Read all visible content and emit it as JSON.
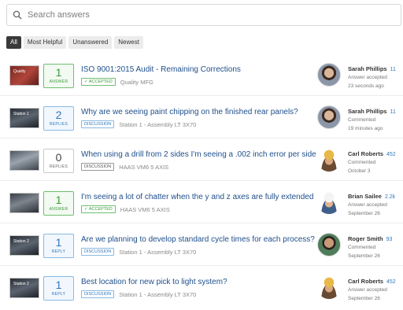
{
  "search": {
    "placeholder": "Search answers"
  },
  "filters": [
    "All",
    "Most Helpful",
    "Unanswered",
    "Newest"
  ],
  "rows": [
    {
      "thumb_label": "Quality",
      "count": "1",
      "count_label": "ANSWER",
      "count_style": "answered",
      "title": "ISO 9001:2015 Audit - Remaining Corrections",
      "tag": "✓ ACCEPTED",
      "tag_style": "accepted",
      "sub": "Quality MFG",
      "user": "Sarah Phillips",
      "rep": "11",
      "action": "Answer accepted",
      "when": "23 seconds ago"
    },
    {
      "thumb_label": "Station 1",
      "count": "2",
      "count_label": "REPLIES",
      "count_style": "replies",
      "title": "Why are we seeing paint chipping on the finished rear panels?",
      "tag": "DISCUSSION",
      "tag_style": "discussion",
      "sub": "Station 1 - Assembly LT 3X70",
      "user": "Sarah Phillips",
      "rep": "11",
      "action": "Commented",
      "when": "19 minutes ago"
    },
    {
      "thumb_label": "",
      "count": "0",
      "count_label": "REPLIES",
      "count_style": "plain",
      "title": "When using a drill from 2 sides I'm seeing a .002 inch error per side",
      "tag": "DISCUSSION",
      "tag_style": "plain",
      "sub": "HAAS VM6 5 AXIS",
      "user": "Carl Roberts",
      "rep": "452",
      "action": "Commented",
      "when": "October 3"
    },
    {
      "thumb_label": "",
      "count": "1",
      "count_label": "ANSWER",
      "count_style": "answered",
      "title": "I'm seeing a lot of chatter when the y and z axes are fully extended",
      "tag": "✓ ACCEPTED",
      "tag_style": "accepted",
      "sub": "HAAS VM6 5 AXIS",
      "user": "Brian Sailee",
      "rep": "2.2k",
      "action": "Answer accepted",
      "when": "September 26"
    },
    {
      "thumb_label": "Station 2",
      "count": "1",
      "count_label": "REPLY",
      "count_style": "replies",
      "title": "Are we planning to develop standard cycle times for each process?",
      "tag": "DISCUSSION",
      "tag_style": "discussion",
      "sub": "Station 1 - Assembly LT 3X70",
      "user": "Roger Smith",
      "rep": "93",
      "action": "Commented",
      "when": "September 26"
    },
    {
      "thumb_label": "Station 2",
      "count": "1",
      "count_label": "REPLY",
      "count_style": "replies",
      "title": "Best location for new pick to light system?",
      "tag": "DISCUSSION",
      "tag_style": "discussion",
      "sub": "Station 1 - Assembly LT 3X70",
      "user": "Carl Roberts",
      "rep": "452",
      "action": "Answer accepted",
      "when": "September 26"
    }
  ]
}
